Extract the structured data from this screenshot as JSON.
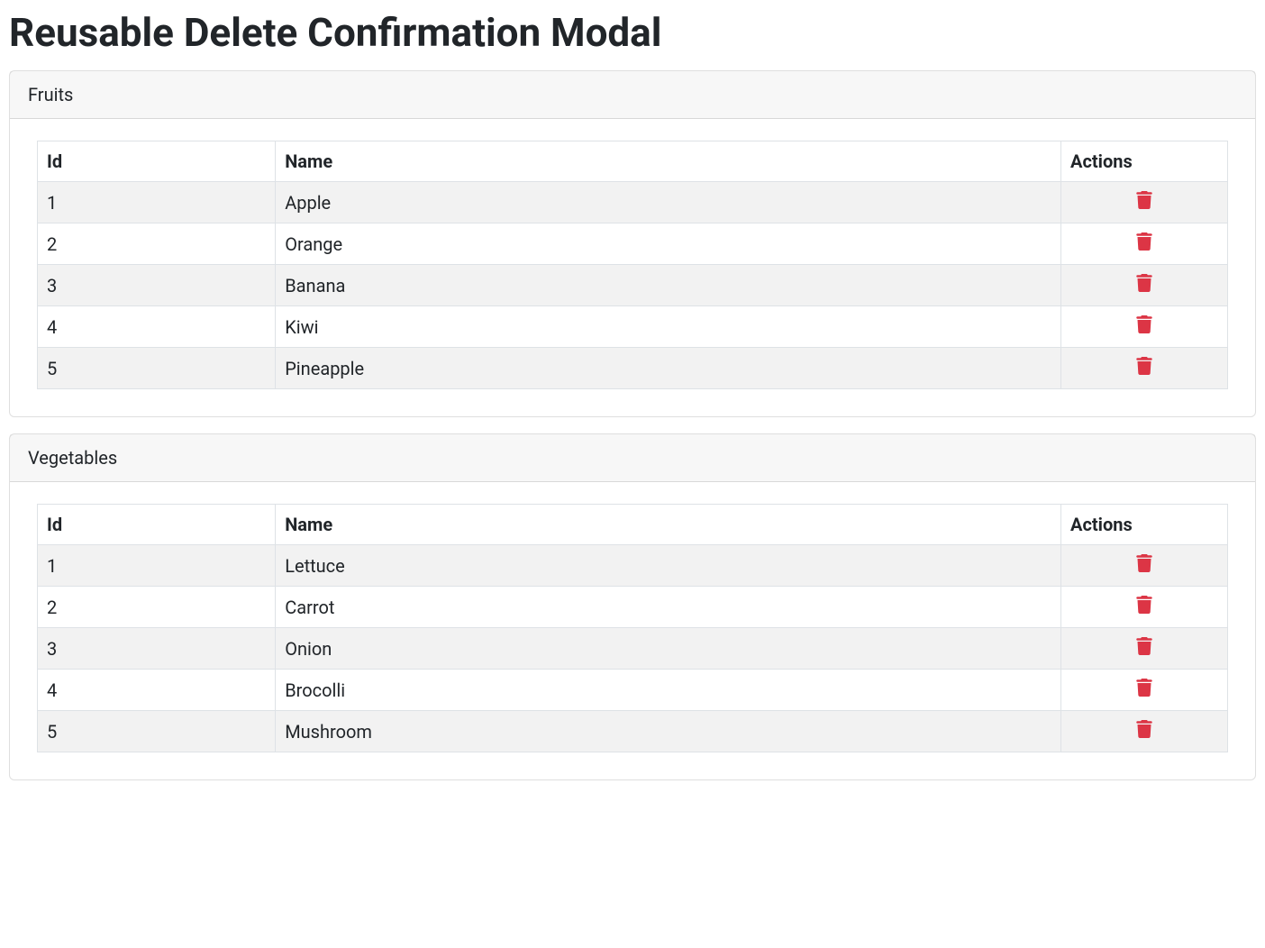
{
  "title": "Reusable Delete Confirmation Modal",
  "columns": {
    "id": "Id",
    "name": "Name",
    "actions": "Actions"
  },
  "cards": [
    {
      "header": "Fruits",
      "rows": [
        {
          "id": "1",
          "name": "Apple"
        },
        {
          "id": "2",
          "name": "Orange"
        },
        {
          "id": "3",
          "name": "Banana"
        },
        {
          "id": "4",
          "name": "Kiwi"
        },
        {
          "id": "5",
          "name": "Pineapple"
        }
      ]
    },
    {
      "header": "Vegetables",
      "rows": [
        {
          "id": "1",
          "name": "Lettuce"
        },
        {
          "id": "2",
          "name": "Carrot"
        },
        {
          "id": "3",
          "name": "Onion"
        },
        {
          "id": "4",
          "name": "Brocolli"
        },
        {
          "id": "5",
          "name": "Mushroom"
        }
      ]
    }
  ]
}
